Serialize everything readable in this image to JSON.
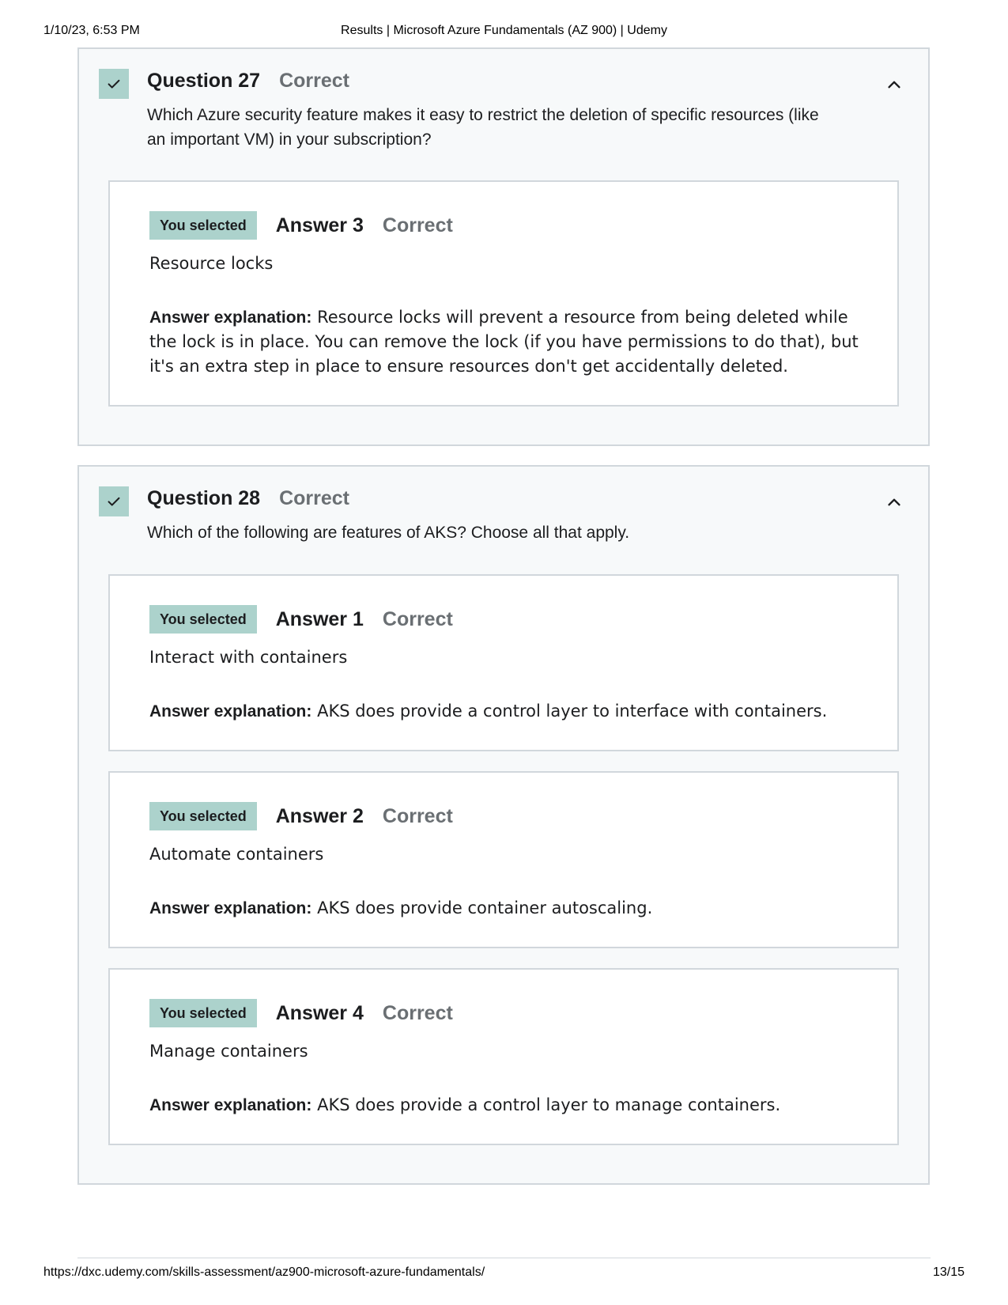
{
  "print_header": {
    "datetime": "1/10/23, 6:53 PM",
    "title": "Results | Microsoft Azure Fundamentals (AZ 900) | Udemy"
  },
  "print_footer": {
    "url": "https://dxc.udemy.com/skills-assessment/az900-microsoft-azure-fundamentals/",
    "page": "13/15"
  },
  "colors": {
    "badge_bg": "#acd2cc",
    "panel_bg": "#f7f9fa",
    "border": "#d1d7dc",
    "muted_text": "#6a6f73"
  },
  "icons": {
    "check": "check-icon",
    "collapse": "chevron-up-icon"
  },
  "questions": [
    {
      "number": "Question 27",
      "status": "Correct",
      "text": "Which Azure security feature makes it easy to restrict the deletion of specific resources (like an important VM) in your subscription?",
      "answers": [
        {
          "badge": "You selected",
          "number": "Answer 3",
          "status": "Correct",
          "text": "Resource locks",
          "explanation_label": "Answer explanation:",
          "explanation": "Resource locks will prevent a resource from being deleted while the lock is in place. You can remove the lock (if you have permissions to do that), but it's an extra step in place to ensure resources don't get accidentally deleted."
        }
      ]
    },
    {
      "number": "Question 28",
      "status": "Correct",
      "text": "Which of the following are features of AKS? Choose all that apply.",
      "answers": [
        {
          "badge": "You selected",
          "number": "Answer 1",
          "status": "Correct",
          "text": "Interact with containers",
          "explanation_label": "Answer explanation:",
          "explanation": "AKS does provide a control layer to interface with containers."
        },
        {
          "badge": "You selected",
          "number": "Answer 2",
          "status": "Correct",
          "text": "Automate containers",
          "explanation_label": "Answer explanation:",
          "explanation": "AKS does provide container autoscaling."
        },
        {
          "badge": "You selected",
          "number": "Answer 4",
          "status": "Correct",
          "text": "Manage containers",
          "explanation_label": "Answer explanation:",
          "explanation": "AKS does provide a control layer to manage containers."
        }
      ]
    }
  ]
}
